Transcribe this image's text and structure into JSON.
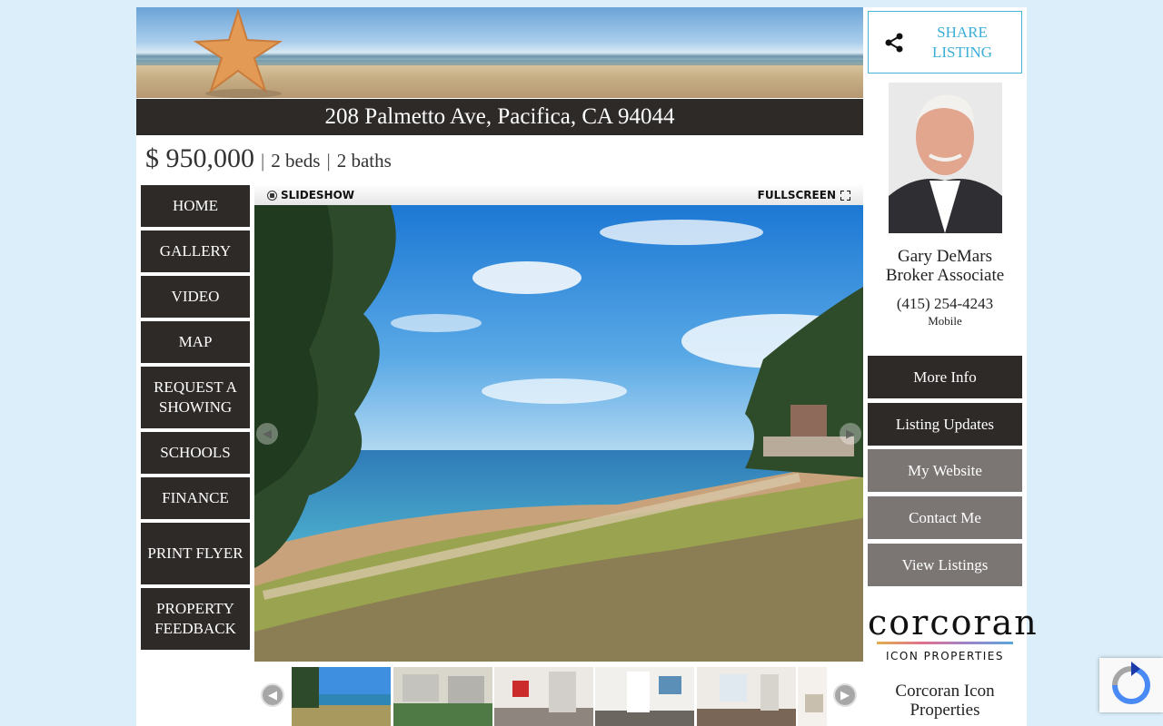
{
  "listing": {
    "address": "208 Palmetto Ave, Pacifica, CA 94044",
    "price": "$ 950,000",
    "separator": "|",
    "beds": "2 beds",
    "baths": "2 baths"
  },
  "nav": {
    "items": [
      {
        "label": "HOME"
      },
      {
        "label": "GALLERY"
      },
      {
        "label": "VIDEO"
      },
      {
        "label": "MAP"
      },
      {
        "label": "REQUEST A SHOWING"
      },
      {
        "label": "SCHOOLS"
      },
      {
        "label": "FINANCE"
      },
      {
        "label": "PRINT FLYER"
      },
      {
        "label": "PROPERTY FEEDBACK"
      }
    ]
  },
  "viewer": {
    "slideshow_label": "SLIDESHOW",
    "fullscreen_label": "FULLSCREEN",
    "prev_icon": "chevron-left-icon",
    "next_icon": "chevron-right-icon"
  },
  "share": {
    "label": "SHARE LISTING",
    "icon": "share-icon",
    "accent": "#3aaed8"
  },
  "agent": {
    "name": "Gary DeMars",
    "title": "Broker Associate",
    "phone": "(415) 254-4243",
    "phone_label": "Mobile"
  },
  "actions": [
    {
      "label": "More Info",
      "style": "dark"
    },
    {
      "label": "Listing Updates",
      "style": "dark"
    },
    {
      "label": "My Website",
      "style": "grey"
    },
    {
      "label": "Contact Me",
      "style": "grey"
    },
    {
      "label": "View Listings",
      "style": "grey"
    }
  ],
  "brokerage": {
    "logo_text": "corcoran",
    "logo_sub": "ICON PROPERTIES",
    "name": "Corcoran Icon Properties"
  },
  "colors": {
    "page_bg": "#dbeefa",
    "nav_bg": "#2e2a28",
    "grey_button": "#7b7674"
  }
}
